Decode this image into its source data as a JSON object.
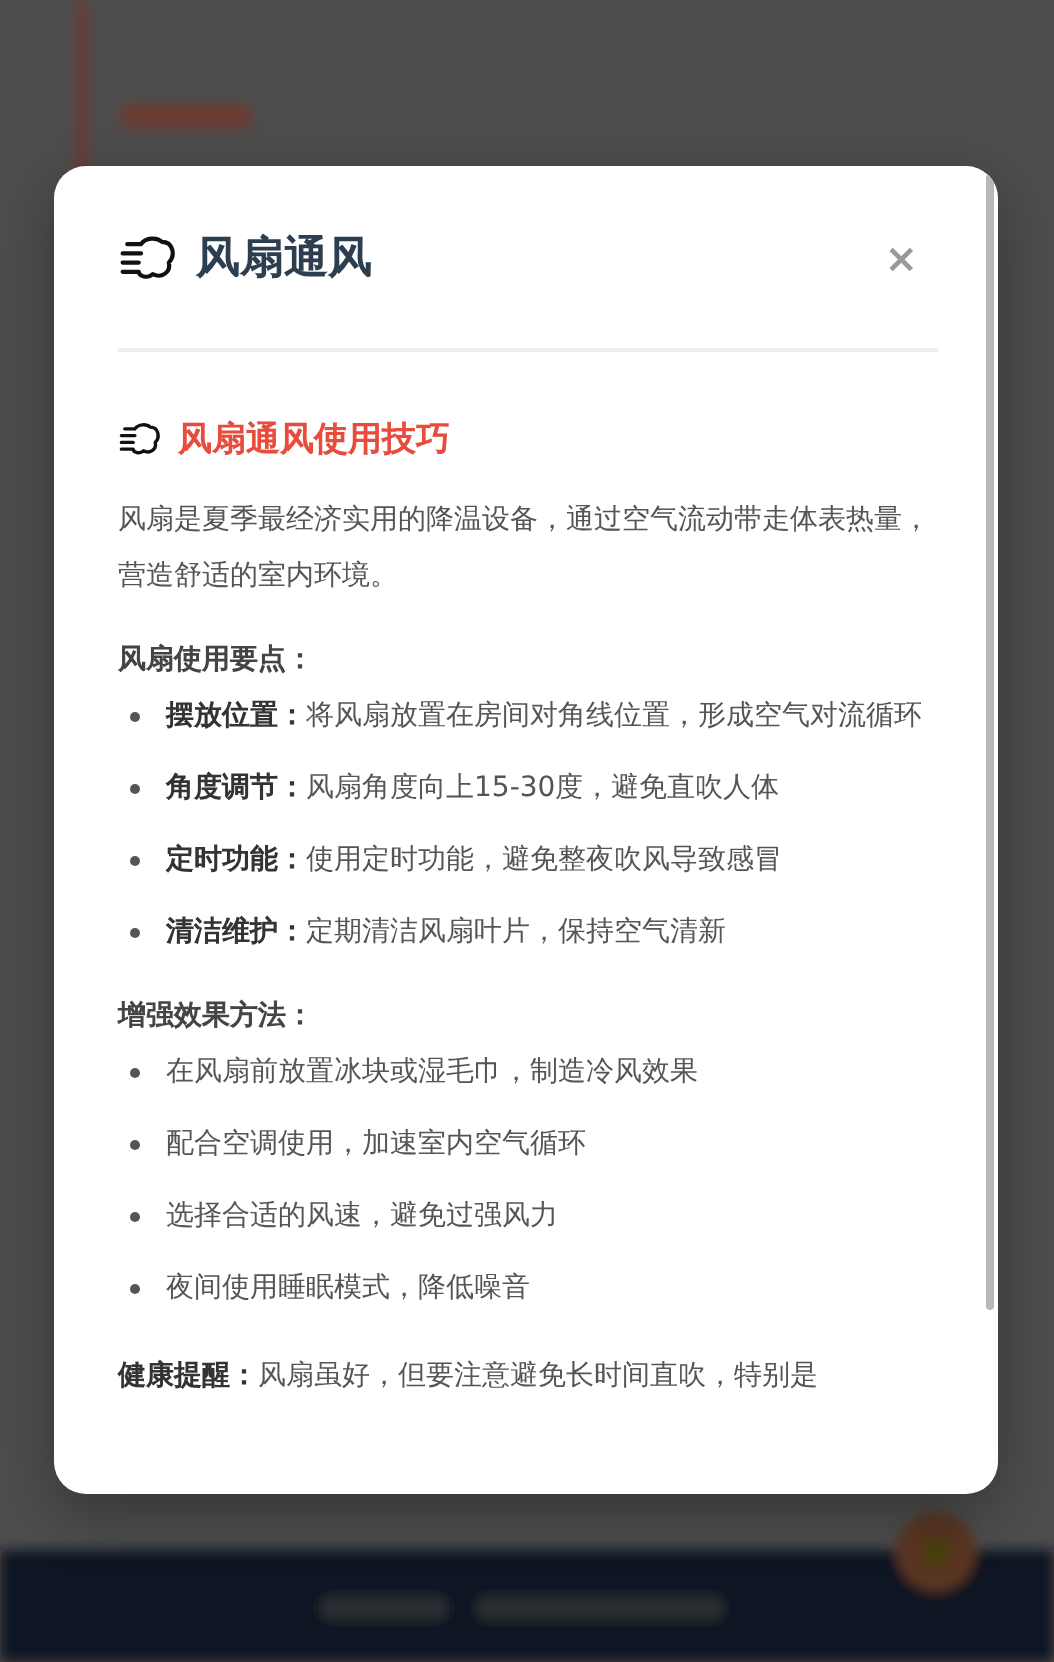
{
  "modal": {
    "title": "风扇通风",
    "close": "×"
  },
  "section_title": "风扇通风使用技巧",
  "intro": "风扇是夏季最经济实用的降温设备，通过空气流动带走体表热量，营造舒适的室内环境。",
  "groups": [
    {
      "heading": "风扇使用要点：",
      "items": [
        {
          "label": "摆放位置：",
          "text": "将风扇放置在房间对角线位置，形成空气对流循环"
        },
        {
          "label": "角度调节：",
          "text": "风扇角度向上15-30度，避免直吹人体"
        },
        {
          "label": "定时功能：",
          "text": "使用定时功能，避免整夜吹风导致感冒"
        },
        {
          "label": "清洁维护：",
          "text": "定期清洁风扇叶片，保持空气清新"
        }
      ]
    },
    {
      "heading": "增强效果方法：",
      "items": [
        {
          "text": "在风扇前放置冰块或湿毛巾，制造冷风效果"
        },
        {
          "text": "配合空调使用，加速室内空气循环"
        },
        {
          "text": "选择合适的风速，避免过强风力"
        },
        {
          "text": "夜间使用睡眠模式，降低噪音"
        }
      ]
    }
  ],
  "note": {
    "label": "健康提醒：",
    "text": "风扇虽好，但要注意避免长时间直吹，特别是"
  }
}
